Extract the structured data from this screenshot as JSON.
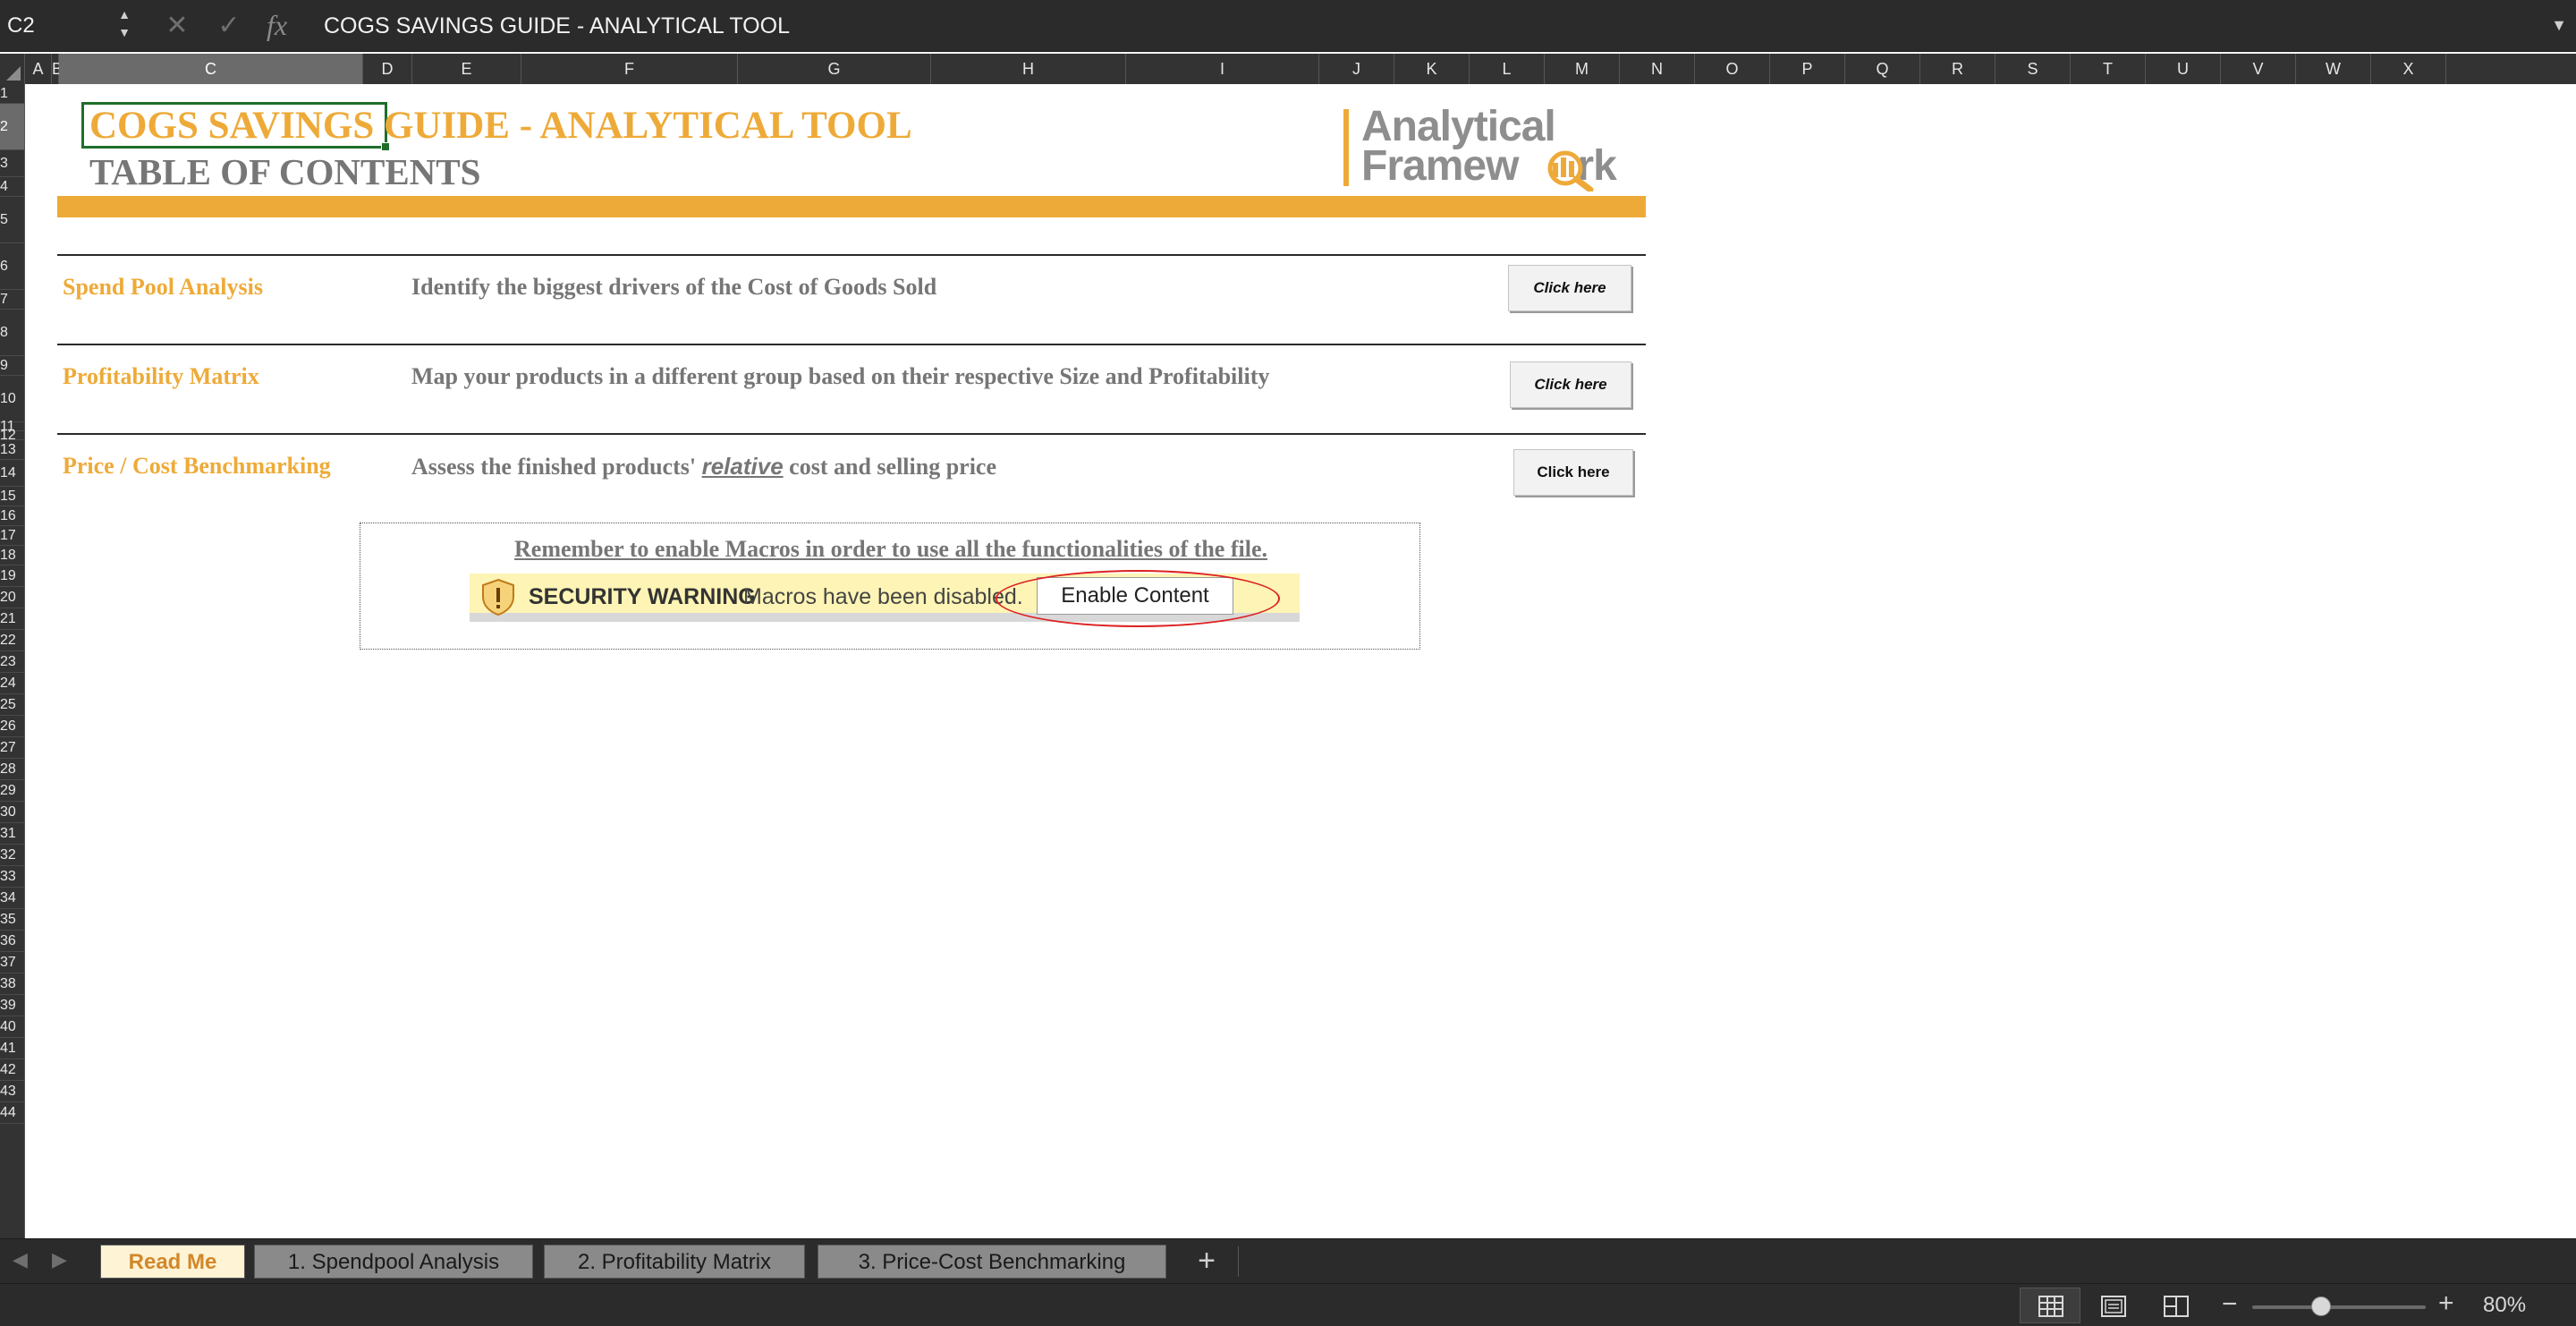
{
  "formula_bar": {
    "name_box": "C2",
    "fx_label": "fx",
    "formula": "COGS SAVINGS GUIDE - ANALYTICAL TOOL"
  },
  "columns": [
    "A",
    "B",
    "C",
    "D",
    "E",
    "F",
    "G",
    "H",
    "I",
    "J",
    "K",
    "L",
    "M",
    "N",
    "O",
    "P",
    "Q",
    "R",
    "S",
    "T",
    "U",
    "V",
    "W",
    "X"
  ],
  "selected_column": "C",
  "rows": [
    "1",
    "2",
    "3",
    "4",
    "5",
    "6",
    "7",
    "8",
    "9",
    "10",
    "11",
    "12",
    "13",
    "14",
    "15",
    "16",
    "17",
    "18",
    "19",
    "20",
    "21",
    "22",
    "23",
    "24",
    "25",
    "26",
    "27",
    "28",
    "29",
    "30",
    "31",
    "32",
    "33",
    "34",
    "35",
    "36",
    "37",
    "38",
    "39",
    "40",
    "41",
    "42",
    "43",
    "44"
  ],
  "selected_row": "2",
  "sheet": {
    "title": "COGS SAVINGS GUIDE - ANALYTICAL TOOL",
    "subtitle": "TABLE OF CONTENTS",
    "logo": {
      "line1": "Analytical",
      "line2_prefix": "Framew",
      "line2_suffix": "rk"
    },
    "toc": [
      {
        "title": "Spend Pool Analysis",
        "description": "Identify the biggest drivers of the Cost of Goods Sold",
        "button": "Click here"
      },
      {
        "title": "Profitability Matrix",
        "description": "Map your products in a different group based on their respective Size and Profitability",
        "button": "Click here"
      },
      {
        "title": "Price / Cost Benchmarking",
        "description_before": "Assess the finished products' ",
        "description_emphasis": "relative",
        "description_after": " cost and selling price",
        "button": "Click here"
      }
    ],
    "macro_note": "Remember to enable Macros in order to use all the functionalities of the file.",
    "security_warning": {
      "label": "SECURITY WARNING",
      "message": "Macros have been disabled.",
      "button": "Enable Content"
    }
  },
  "tabs": [
    {
      "label": "Read Me",
      "active": true
    },
    {
      "label": "1. Spendpool Analysis",
      "active": false
    },
    {
      "label": "2. Profitability Matrix",
      "active": false
    },
    {
      "label": "3. Price-Cost Benchmarking",
      "active": false
    }
  ],
  "add_sheet_label": "+",
  "status": {
    "zoom_level": "80%",
    "zoom_fraction": 0.4
  },
  "colors": {
    "accent_orange": "#eeaa38",
    "text_gray": "#767676",
    "warning_yellow": "#fdf4b5",
    "highlight_red": "#dd2222"
  }
}
